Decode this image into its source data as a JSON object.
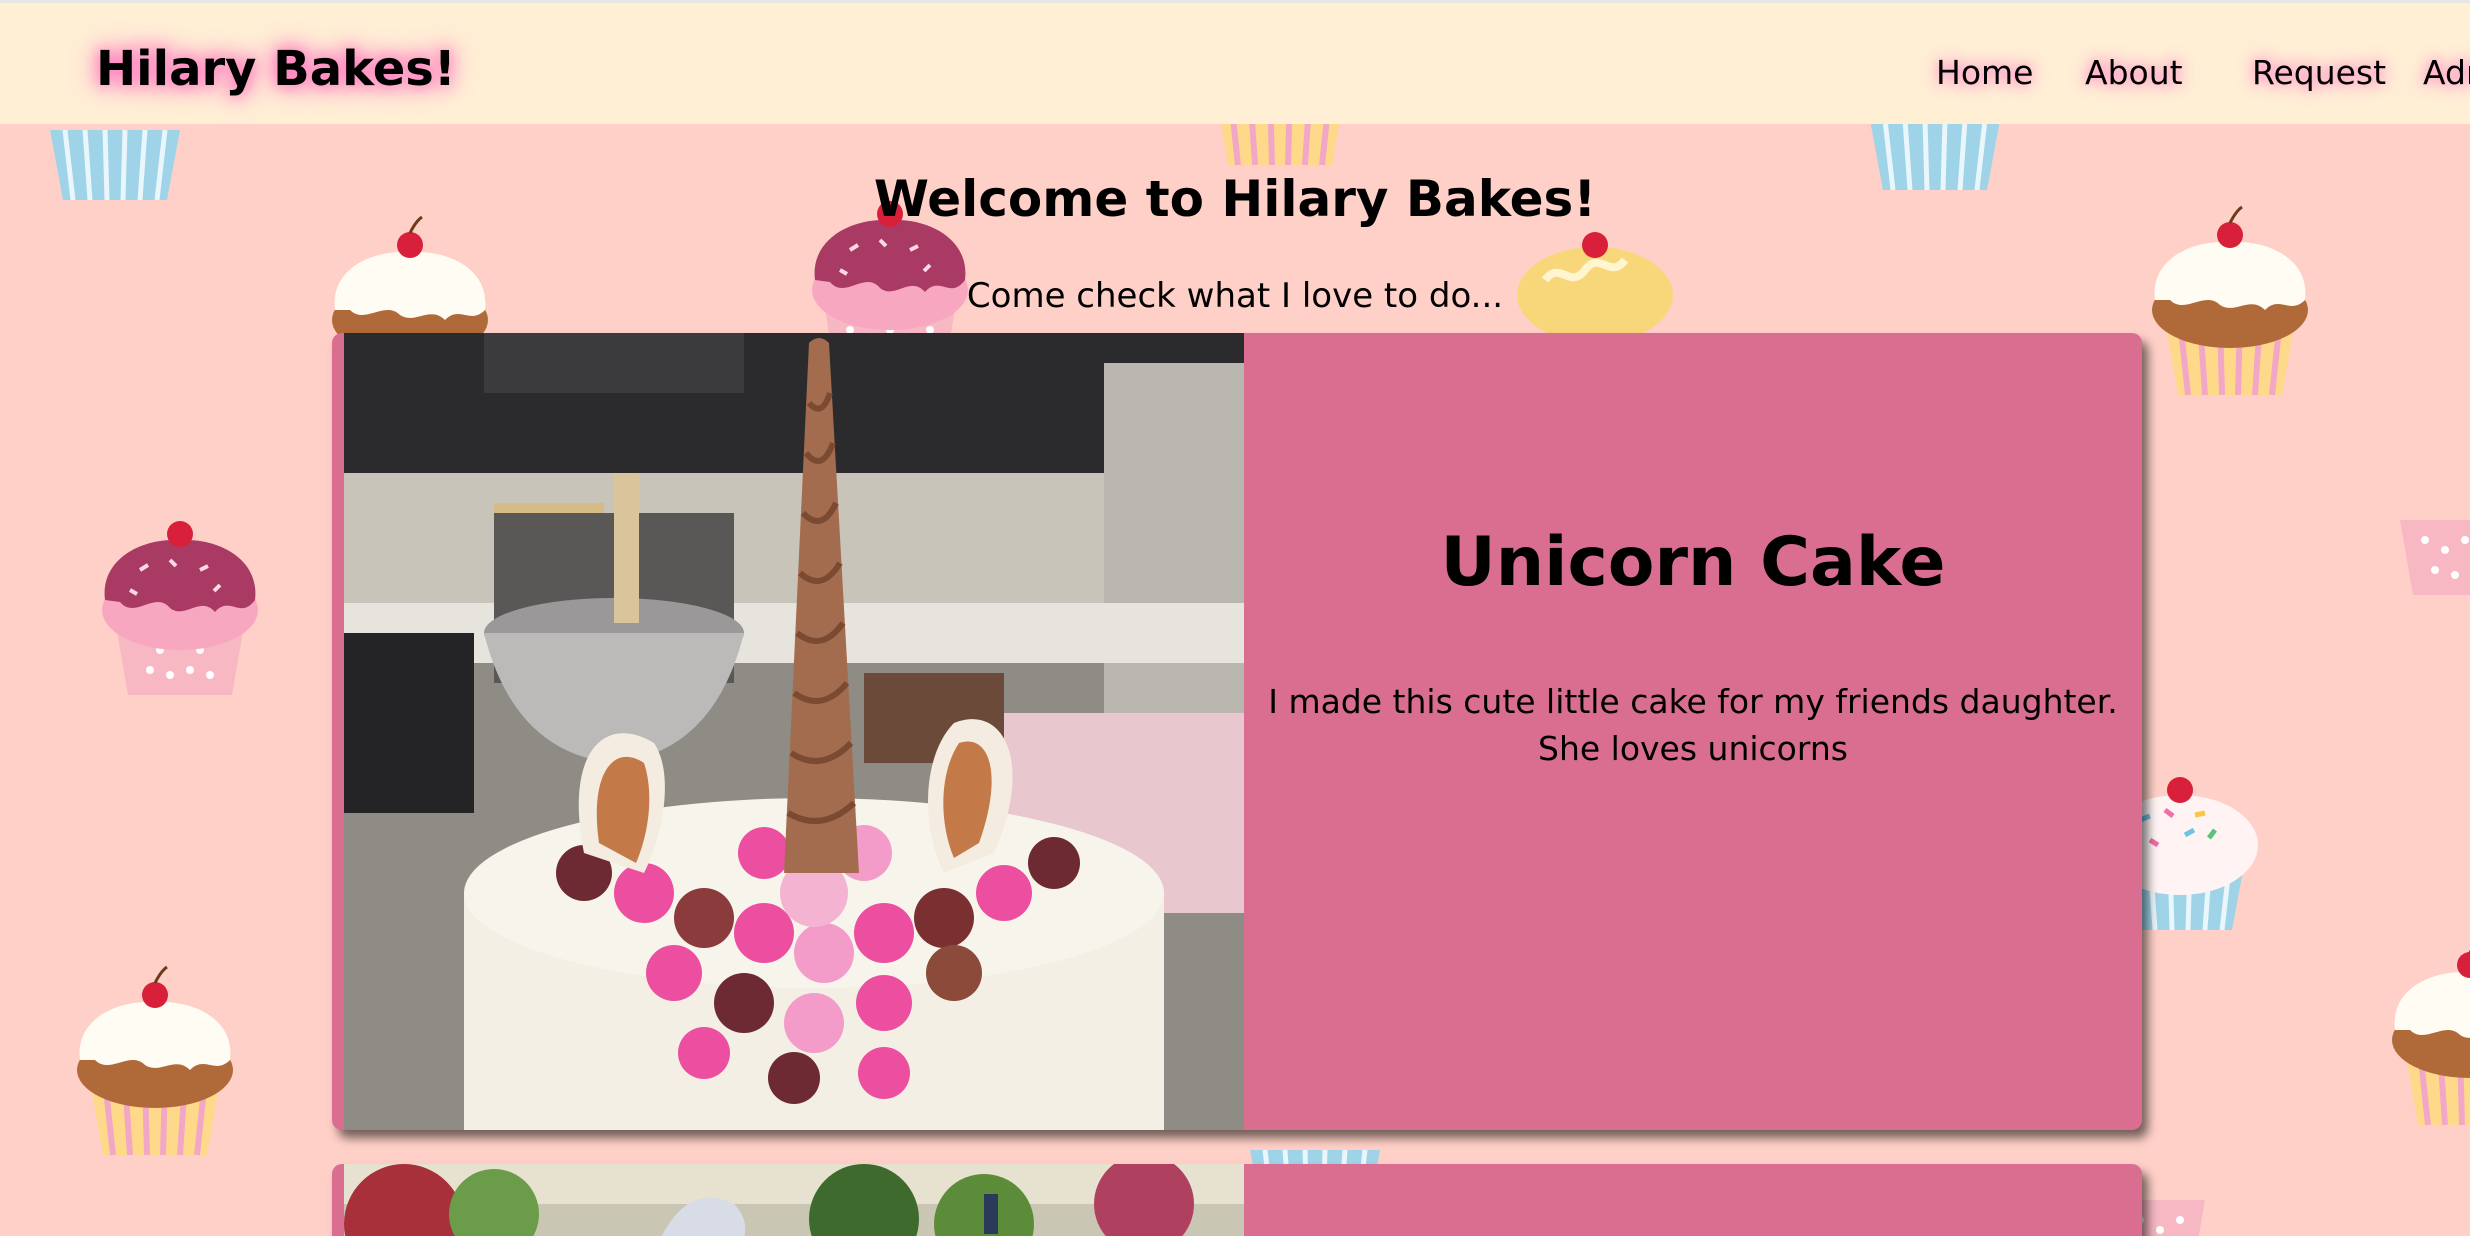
{
  "site": {
    "brand": "Hilary Bakes!"
  },
  "nav": {
    "links": [
      "Home",
      "About",
      "Request",
      "Admin"
    ]
  },
  "hero": {
    "title": "Welcome to Hilary Bakes!",
    "subtitle": "Come check what I love to do..."
  },
  "cards": [
    {
      "title": "Unicorn Cake",
      "description": "I made this cute little cake for my friends daughter. She loves unicorns"
    },
    {
      "title": "",
      "description": ""
    }
  ],
  "colors": {
    "page_background": "#ffd0c8",
    "navbar_background": "#ffefd5",
    "card_background": "#d96e91",
    "glow": "#ff7fbf"
  }
}
